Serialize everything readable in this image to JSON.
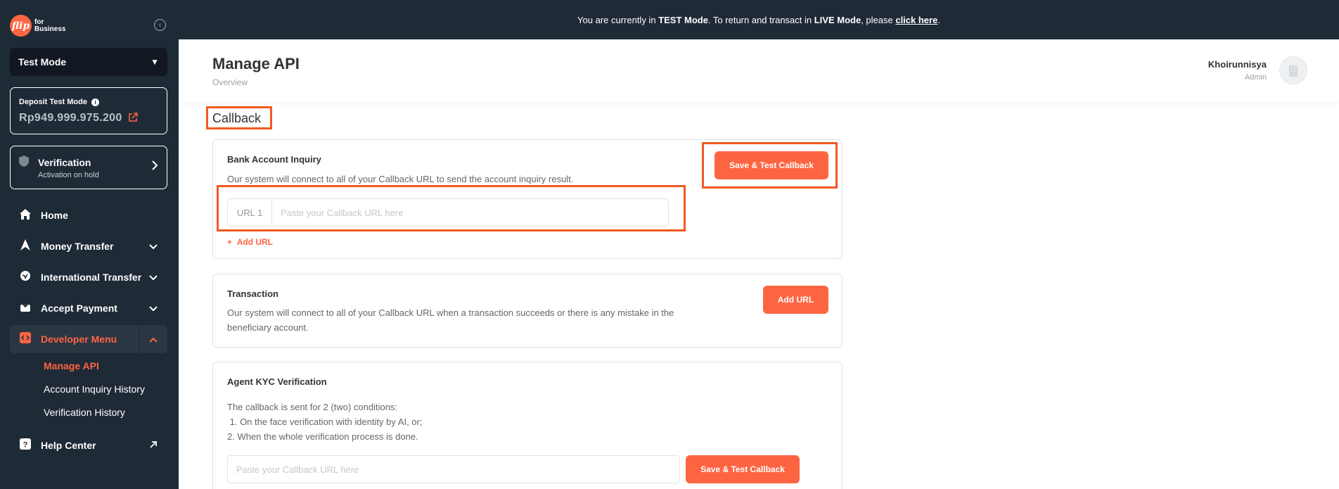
{
  "sidebar": {
    "logo_mark": "flip",
    "logo_text_1": "for",
    "logo_text_2": "Business",
    "collapse_glyph": "‹",
    "mode": "Test Mode",
    "deposit_label": "Deposit Test Mode",
    "deposit_amount": "Rp949.999.975.200",
    "verification_title": "Verification",
    "verification_sub": "Activation on hold",
    "nav": [
      {
        "label": "Home",
        "icon": "home-icon"
      },
      {
        "label": "Money Transfer",
        "icon": "send-icon"
      },
      {
        "label": "International Transfer",
        "icon": "globe-icon"
      },
      {
        "label": "Accept Payment",
        "icon": "payment-icon"
      },
      {
        "label": "Developer Menu",
        "icon": "code-icon"
      },
      {
        "label": "Help Center",
        "icon": "help-icon"
      }
    ],
    "developer_sub": [
      "Manage API",
      "Account Inquiry History",
      "Verification History"
    ]
  },
  "banner": {
    "pre": "You are currently in ",
    "mode1": "TEST Mode",
    "mid": ". To return and transact in ",
    "mode2": "LIVE Mode",
    "mid2": ", please ",
    "link": "click here",
    "end": "."
  },
  "header": {
    "title": "Manage API",
    "subtitle": "Overview",
    "user_name": "Khoirunnisya",
    "user_role": "Admin"
  },
  "main": {
    "section_title": "Callback",
    "bank_inquiry": {
      "title": "Bank Account Inquiry",
      "desc": "Our system will connect to all of your Callback URL to send the account inquiry result.",
      "button": "Save & Test Callback",
      "url_prefix": "URL 1",
      "url_placeholder": "Paste your Callback URL here",
      "url_value": "",
      "add_url": "Add URL"
    },
    "transaction": {
      "title": "Transaction",
      "desc_line1": "Our system will connect to all of your Callback URL when a transaction succeeds or there is any mistake in the",
      "desc_line2": "beneficiary account.",
      "button": "Add URL"
    },
    "kyc": {
      "title": "Agent KYC Verification",
      "desc_line1": "The callback is sent for 2 (two) conditions:",
      "desc_line2": " 1. On the face verification with identity by AI, or;",
      "desc_line3": "2. When the whole verification process is done.",
      "placeholder": "Paste your Callback URL here",
      "button": "Save & Test Callback"
    }
  },
  "colors": {
    "accent": "#fd6542",
    "sidebar_bg": "#1f2a37",
    "highlight": "#f05a22"
  }
}
